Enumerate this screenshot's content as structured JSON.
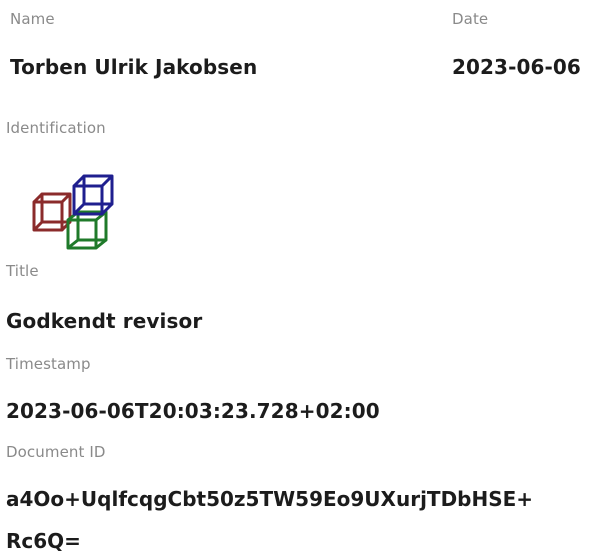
{
  "name": {
    "label": "Name",
    "value": "Torben Ulrik Jakobsen"
  },
  "date": {
    "label": "Date",
    "value": "2023-06-06"
  },
  "identification": {
    "label": "Identification",
    "logo_icon": "cubes-logo-icon",
    "colors": {
      "red": "#8b2b2b",
      "blue": "#1f1f8f",
      "green": "#1f7a2a"
    }
  },
  "title": {
    "label": "Title",
    "value": "Godkendt revisor"
  },
  "timestamp": {
    "label": "Timestamp",
    "value": "2023-06-06T20:03:23.728+02:00"
  },
  "document_id": {
    "label": "Document ID",
    "line1": "a4Oo+UqlfcqgCbt50z5TW59Eo9UXurjTDbHSE+",
    "line2": "Rc6Q="
  }
}
